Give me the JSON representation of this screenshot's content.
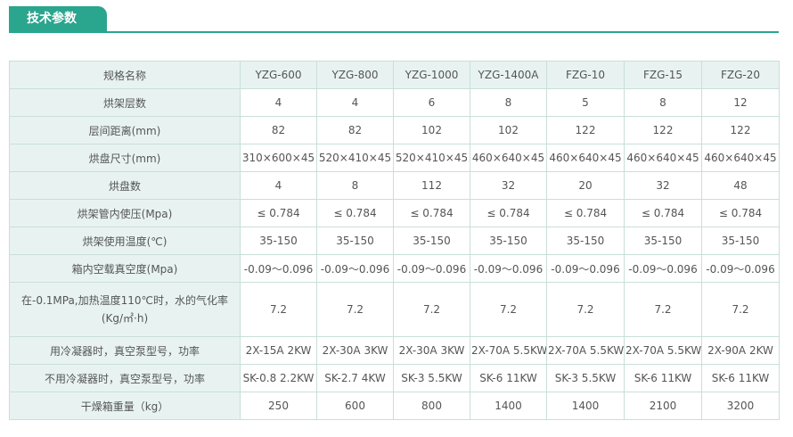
{
  "header": {
    "title": "技术参数"
  },
  "colors": {
    "accent": "#2aa58e",
    "label_bg": "#e8f3f1",
    "border": "#c9dfd9"
  },
  "table": {
    "columns": [
      "规格名称",
      "YZG-600",
      "YZG-800",
      "YZG-1000",
      "YZG-1400A",
      "FZG-10",
      "FZG-15",
      "FZG-20"
    ],
    "rows": [
      {
        "label": "烘架层数",
        "values": [
          "4",
          "4",
          "6",
          "8",
          "5",
          "8",
          "12"
        ]
      },
      {
        "label": "层间距离(mm)",
        "values": [
          "82",
          "82",
          "102",
          "102",
          "122",
          "122",
          "122"
        ]
      },
      {
        "label": "烘盘尺寸(mm)",
        "values": [
          "310×600×45",
          "520×410×45",
          "520×410×45",
          "460×640×45",
          "460×640×45",
          "460×640×45",
          "460×640×45"
        ]
      },
      {
        "label": "烘盘数",
        "values": [
          "4",
          "8",
          "112",
          "32",
          "20",
          "32",
          "48"
        ]
      },
      {
        "label": "烘架管内使压(Mpa)",
        "values": [
          "≤ 0.784",
          "≤ 0.784",
          "≤ 0.784",
          "≤ 0.784",
          "≤ 0.784",
          "≤ 0.784",
          "≤ 0.784"
        ]
      },
      {
        "label": "烘架使用温度(℃)",
        "values": [
          "35-150",
          "35-150",
          "35-150",
          "35-150",
          "35-150",
          "35-150",
          "35-150"
        ]
      },
      {
        "label": "箱内空载真空度(Mpa)",
        "values": [
          "-0.09～0.096",
          "-0.09～0.096",
          "-0.09～0.096",
          "-0.09～0.096",
          "-0.09～0.096",
          "-0.09～0.096",
          "-0.09～0.096"
        ]
      },
      {
        "label": "在-0.1MPa,加热温度110℃时，水的气化率(Kg/㎡·h)",
        "values": [
          "7.2",
          "7.2",
          "7.2",
          "7.2",
          "7.2",
          "7.2",
          "7.2"
        ]
      },
      {
        "label": "用冷凝器时，真空泵型号，功率",
        "values": [
          "2X-15A 2KW",
          "2X-30A 3KW",
          "2X-30A 3KW",
          "2X-70A 5.5KW",
          "2X-70A 5.5KW",
          "2X-70A 5.5KW",
          "2X-90A 2KW"
        ]
      },
      {
        "label": "不用冷凝器时，真空泵型号，功率",
        "values": [
          "SK-0.8 2.2KW",
          "SK-2.7 4KW",
          "SK-3 5.5KW",
          "SK-6 11KW",
          "SK-3 5.5KW",
          "SK-6 11KW",
          "SK-6 11KW"
        ]
      },
      {
        "label": "干燥箱重量（kg）",
        "values": [
          "250",
          "600",
          "800",
          "1400",
          "1400",
          "2100",
          "3200"
        ]
      }
    ]
  }
}
